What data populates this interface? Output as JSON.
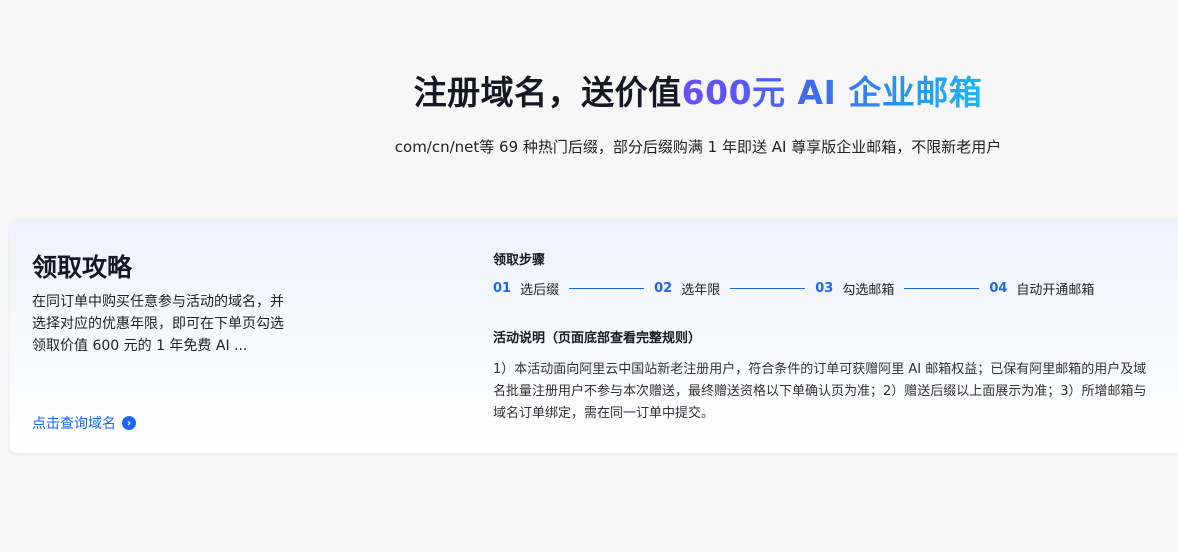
{
  "hero": {
    "title_plain": "注册域名，送价值",
    "title_highlight": "600元 AI 企业邮箱",
    "subtitle": "com/cn/net等 69 种热门后缀，部分后缀购满 1 年即送 AI 尊享版企业邮箱，不限新老用户"
  },
  "guide": {
    "title": "领取攻略",
    "description": "在同订单中购买任意参与活动的域名，并选择对应的优惠年限，即可在下单页勾选领取价值 600 元的 1 年免费 AI ...",
    "link_label": "点击查询域名",
    "link_icon": "chevron-right-circle-icon"
  },
  "steps": {
    "label": "领取步骤",
    "items": [
      {
        "num": "01",
        "name": "选后缀"
      },
      {
        "num": "02",
        "name": "选年限"
      },
      {
        "num": "03",
        "name": "勾选邮箱"
      },
      {
        "num": "04",
        "name": "自动开通邮箱"
      }
    ]
  },
  "notes": {
    "label": "活动说明（页面底部查看完整规则）",
    "text": "1）本活动面向阿里云中国站新老注册用户，符合条件的订单可获赠阿里 AI 邮箱权益；已保有阿里邮箱的用户及域名批量注册用户不参与本次赠送，最终赠送资格以下单确认页为准；2）赠送后缀以上面展示为准；3）所增邮箱与域名订单绑定，需在同一订单中提交。"
  },
  "colors": {
    "accent": "#1a66ff",
    "gradient_start": "#6b4cf5",
    "gradient_end": "#19b8f0"
  }
}
